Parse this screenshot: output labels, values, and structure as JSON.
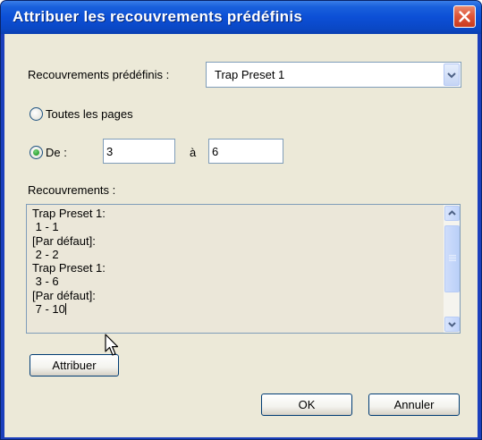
{
  "window": {
    "title": "Attribuer les recouvrements prédéfinis"
  },
  "presets": {
    "label": "Recouvrements prédéfinis :",
    "selected": "Trap Preset 1"
  },
  "range": {
    "all_pages_label": "Toutes les pages",
    "from_label": "De :",
    "from_value": "3",
    "to_label": "à",
    "to_value": "6",
    "selected_option": "from"
  },
  "traps": {
    "label": "Recouvrements :",
    "lines": [
      "Trap Preset 1:",
      " 1 - 1",
      "[Par défaut]:",
      " 2 - 2",
      "Trap Preset 1:",
      " 3 - 6",
      "[Par défaut]:",
      " 7 - 10"
    ]
  },
  "buttons": {
    "assign": "Attribuer",
    "ok": "OK",
    "cancel": "Annuler"
  },
  "colors": {
    "titlebar": "#0c4fd6",
    "dialog_bg": "#ece9d8",
    "close_button": "#e0573a",
    "listbox_bg": "#ebe7d9"
  }
}
